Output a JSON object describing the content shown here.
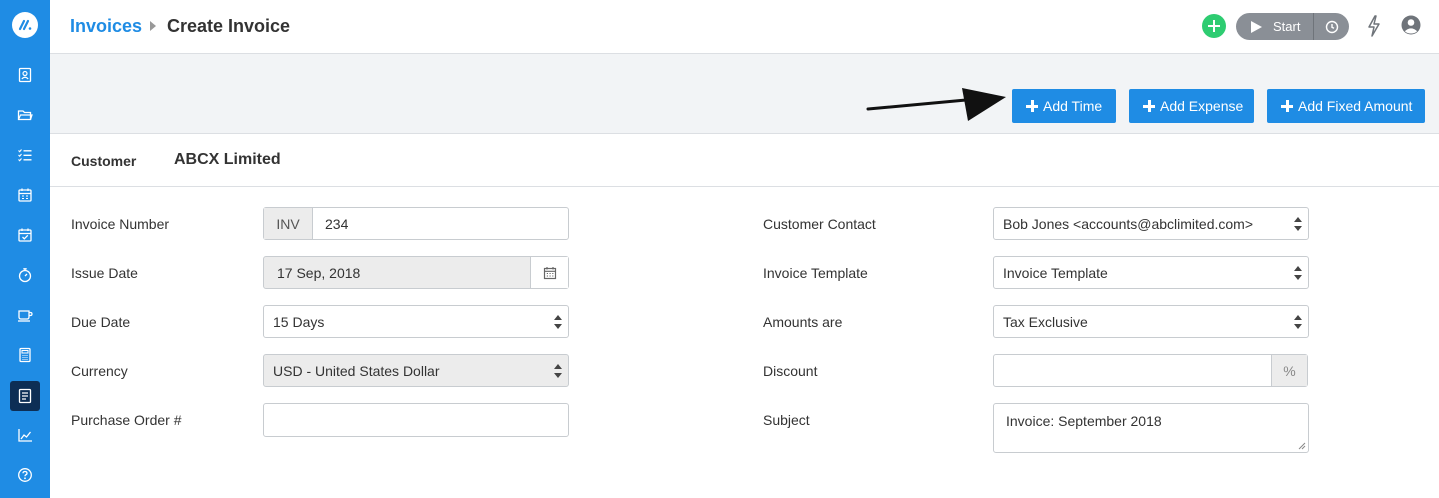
{
  "sidebar": {
    "icons": [
      "contacts-icon",
      "folder-icon",
      "task-list-icon",
      "calendar-icon",
      "calendar-check-icon",
      "stopwatch-icon",
      "coffee-icon",
      "calculator-icon",
      "invoice-icon",
      "chart-icon",
      "help-icon"
    ],
    "active": "invoice-icon"
  },
  "header": {
    "breadcrumb_link": "Invoices",
    "title": "Create Invoice",
    "timer_label": "Start"
  },
  "toolbar": {
    "add_time": "Add Time",
    "add_expense": "Add Expense",
    "add_fixed_amount": "Add Fixed Amount"
  },
  "customer": {
    "label": "Customer",
    "name": "ABCX Limited"
  },
  "form": {
    "invoice_number": {
      "label": "Invoice Number",
      "prefix": "INV",
      "value": "234"
    },
    "issue_date": {
      "label": "Issue Date",
      "value": "17 Sep, 2018"
    },
    "due_date": {
      "label": "Due Date",
      "value": "15 Days"
    },
    "currency": {
      "label": "Currency",
      "value": "USD - United States Dollar"
    },
    "purchase_order": {
      "label": "Purchase Order #",
      "value": ""
    },
    "customer_contact": {
      "label": "Customer Contact",
      "value": "Bob Jones <accounts@abclimited.com>"
    },
    "invoice_template": {
      "label": "Invoice Template",
      "value": "Invoice Template"
    },
    "amounts_are": {
      "label": "Amounts are",
      "value": "Tax Exclusive"
    },
    "discount": {
      "label": "Discount",
      "value": "",
      "suffix": "%"
    },
    "subject": {
      "label": "Subject",
      "value": "Invoice: September 2018"
    }
  },
  "colors": {
    "brand_blue": "#1f8ce4",
    "active_nav": "#0d2e55",
    "add_green": "#2ecc71"
  }
}
